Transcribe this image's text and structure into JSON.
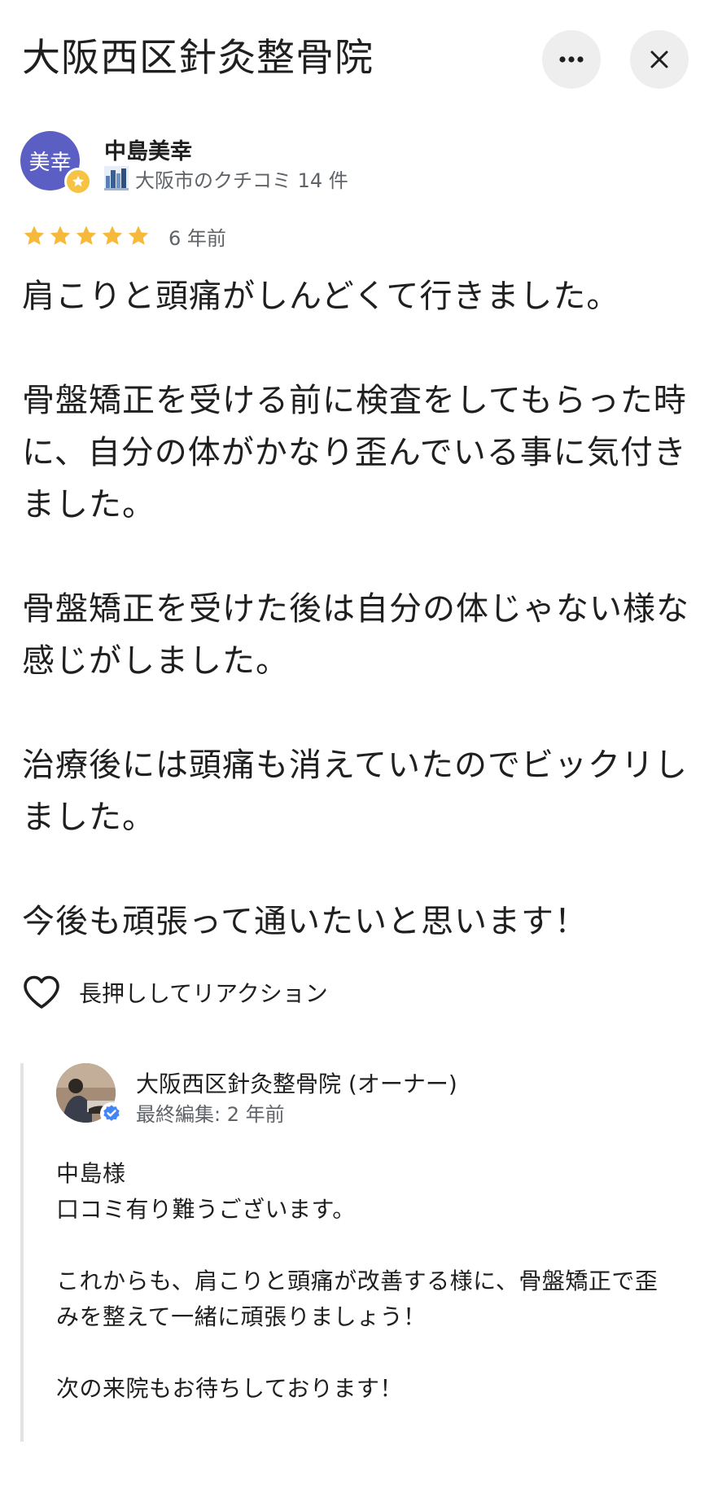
{
  "header": {
    "title": "大阪西区針灸整骨院",
    "more_icon": "more-horizontal-icon",
    "close_icon": "close-icon"
  },
  "review": {
    "reviewer": {
      "avatar_text": "美幸",
      "avatar_color": "#5b5fc4",
      "name": "中島美幸",
      "meta": "大阪市のクチコミ 14 件",
      "badge_icon": "local-guide-star-icon",
      "meta_icon": "city-icon"
    },
    "rating": 5,
    "rating_max": 5,
    "star_color": "#f6b93b",
    "date": "6 年前",
    "paragraphs": [
      "肩こりと頭痛がしんどくて行きました。",
      "骨盤矯正を受ける前に検査をしてもらった時に、自分の体がかなり歪んでいる事に気付きました。",
      "骨盤矯正を受けた後は自分の体じゃない様な感じがしました。",
      "治療後には頭痛も消えていたのでビックリしました。",
      "今後も頑張って通いたいと思います！"
    ],
    "reaction_label": "長押ししてリアクション"
  },
  "owner_reply": {
    "name": "大阪西区針灸整骨院 (オーナー)",
    "edited": "最終編集: 2 年前",
    "verified_color": "#4285f4",
    "paragraphs": [
      "中島様\n口コミ有り難うございます。",
      "これからも、肩こりと頭痛が改善する様に、骨盤矯正で歪みを整えて一緒に頑張りましょう！",
      "次の来院もお待ちしております！"
    ]
  }
}
